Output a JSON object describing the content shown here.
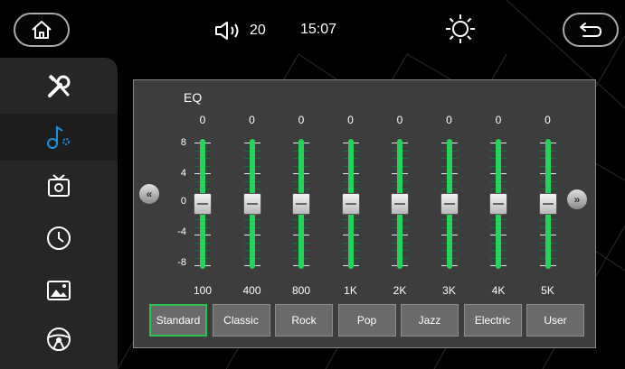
{
  "status": {
    "volume": "20",
    "time": "15:07"
  },
  "icons": {
    "home": "home-icon",
    "back": "back-icon",
    "volume": "speaker-icon",
    "brightness": "sun-icon",
    "prev": "double-chevron-left-icon",
    "next": "double-chevron-right-icon"
  },
  "sidebar": {
    "items": [
      {
        "icon": "tools-icon",
        "active": false
      },
      {
        "icon": "music-settings-icon",
        "active": true
      },
      {
        "icon": "tv-settings-icon",
        "active": false
      },
      {
        "icon": "clock-icon",
        "active": false
      },
      {
        "icon": "picture-icon",
        "active": false
      },
      {
        "icon": "steering-wheel-icon",
        "active": false
      }
    ]
  },
  "eq": {
    "title": "EQ",
    "scale": [
      "8",
      "4",
      "0",
      "-4",
      "-8"
    ],
    "range": [
      -8,
      8
    ],
    "bands": [
      {
        "value": "0",
        "freq": "100"
      },
      {
        "value": "0",
        "freq": "400"
      },
      {
        "value": "0",
        "freq": "800"
      },
      {
        "value": "0",
        "freq": "1K"
      },
      {
        "value": "0",
        "freq": "2K"
      },
      {
        "value": "0",
        "freq": "3K"
      },
      {
        "value": "0",
        "freq": "4K"
      },
      {
        "value": "0",
        "freq": "5K"
      }
    ],
    "presets": [
      "Standard",
      "Classic",
      "Rock",
      "Pop",
      "Jazz",
      "Electric",
      "User"
    ],
    "selected_preset": "Standard"
  },
  "colors": {
    "accent": "#1c8fe0",
    "slider": "#23d35a",
    "selected": "#28c44d"
  }
}
